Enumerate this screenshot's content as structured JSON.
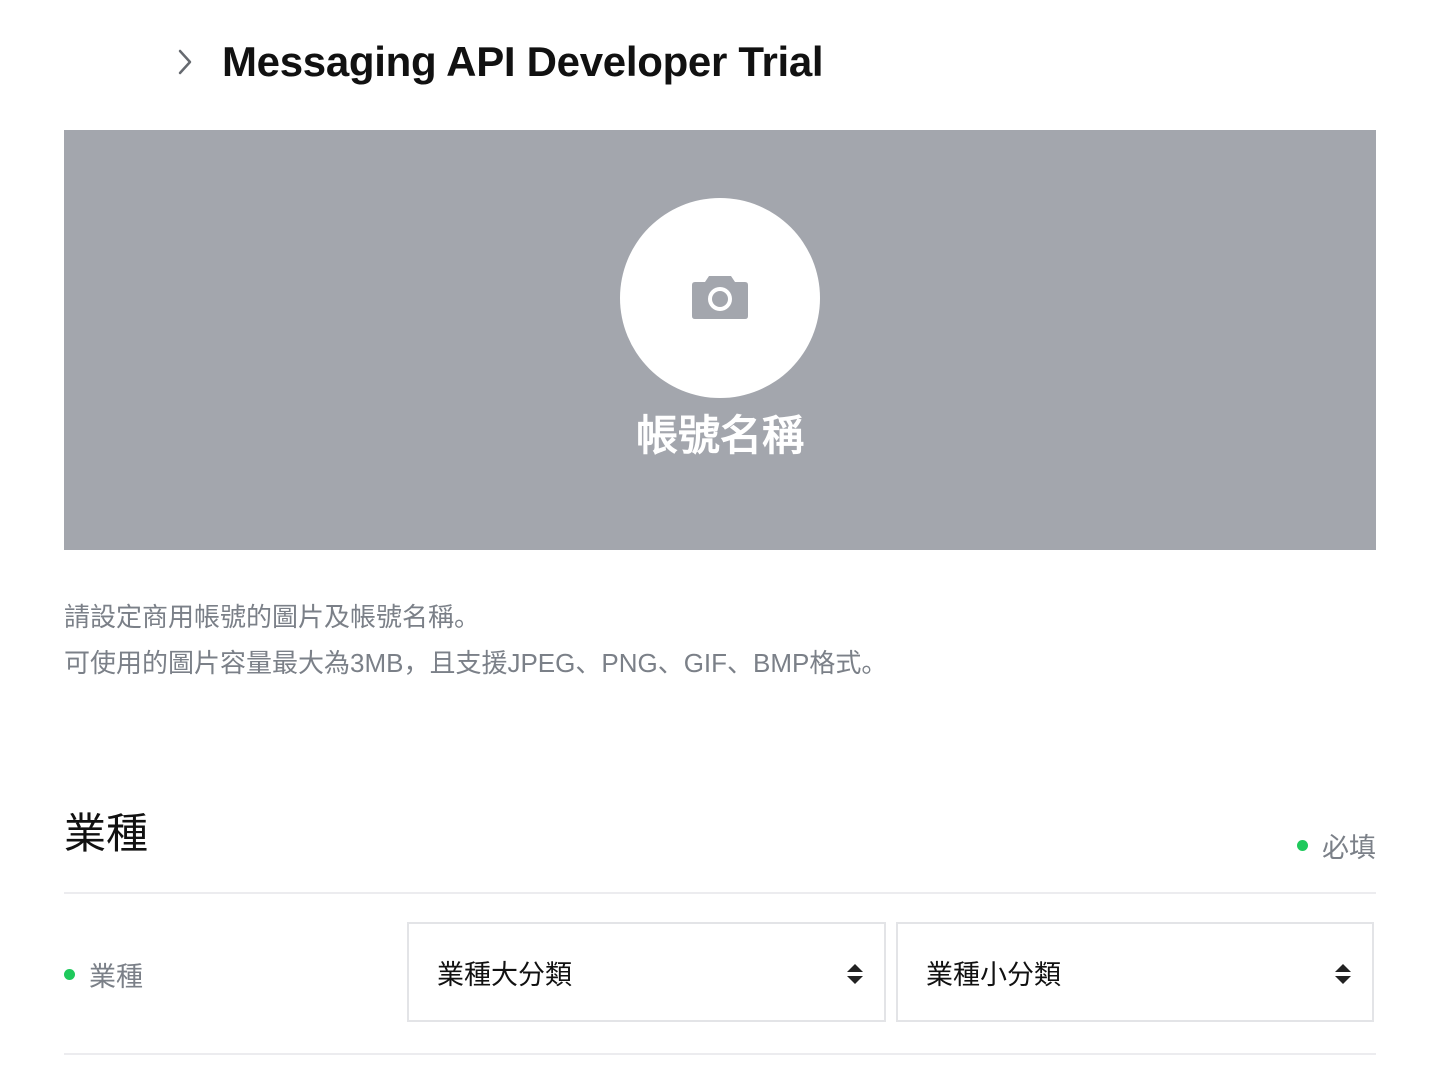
{
  "header": {
    "title": "Messaging API Developer Trial"
  },
  "cover": {
    "account_name": "帳號名稱"
  },
  "description": {
    "line1": "請設定商用帳號的圖片及帳號名稱。",
    "line2": "可使用的圖片容量最大為3MB，且支援JPEG、PNG、GIF、BMP格式。"
  },
  "industry_section": {
    "title": "業種",
    "required_label": "必填",
    "field_label": "業種",
    "major_select": {
      "value": "業種大分類"
    },
    "minor_select": {
      "value": "業種小分類"
    }
  },
  "icons": {
    "breadcrumb": "chevron-right-icon",
    "upload": "camera-icon",
    "select": "sort-arrows-icon"
  },
  "colors": {
    "cover_bg": "#a3a6ad",
    "required_dot": "#1fc95c",
    "muted_text": "#7b8088"
  }
}
